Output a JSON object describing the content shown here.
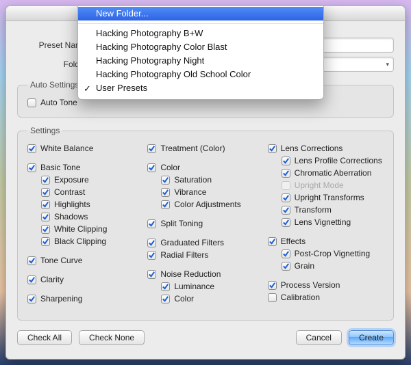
{
  "form": {
    "preset_name_label": "Preset Name:",
    "folder_label": "Folder:"
  },
  "dropdown": {
    "new_folder": "New Folder...",
    "items": [
      "Hacking Photography B+W",
      "Hacking Photography Color Blast",
      "Hacking Photography Night",
      "Hacking Photography Old School Color",
      "User Presets"
    ],
    "selected_index": 4
  },
  "auto_settings": {
    "legend": "Auto Settings",
    "auto_tone": "Auto Tone"
  },
  "settings": {
    "legend": "Settings",
    "col1": {
      "white_balance": "White Balance",
      "basic_tone": "Basic Tone",
      "exposure": "Exposure",
      "contrast": "Contrast",
      "highlights": "Highlights",
      "shadows": "Shadows",
      "white_clipping": "White Clipping",
      "black_clipping": "Black Clipping",
      "tone_curve": "Tone Curve",
      "clarity": "Clarity",
      "sharpening": "Sharpening"
    },
    "col2": {
      "treatment": "Treatment (Color)",
      "color": "Color",
      "saturation": "Saturation",
      "vibrance": "Vibrance",
      "color_adjustments": "Color Adjustments",
      "split_toning": "Split Toning",
      "graduated_filters": "Graduated Filters",
      "radial_filters": "Radial Filters",
      "noise_reduction": "Noise Reduction",
      "luminance": "Luminance",
      "color_nr": "Color"
    },
    "col3": {
      "lens_corrections": "Lens Corrections",
      "lens_profile": "Lens Profile Corrections",
      "chromatic": "Chromatic Aberration",
      "upright_mode": "Upright Mode",
      "upright_transforms": "Upright Transforms",
      "transform": "Transform",
      "lens_vignetting": "Lens Vignetting",
      "effects": "Effects",
      "post_crop": "Post-Crop Vignetting",
      "grain": "Grain",
      "process_version": "Process Version",
      "calibration": "Calibration"
    }
  },
  "buttons": {
    "check_all": "Check All",
    "check_none": "Check None",
    "cancel": "Cancel",
    "create": "Create"
  }
}
